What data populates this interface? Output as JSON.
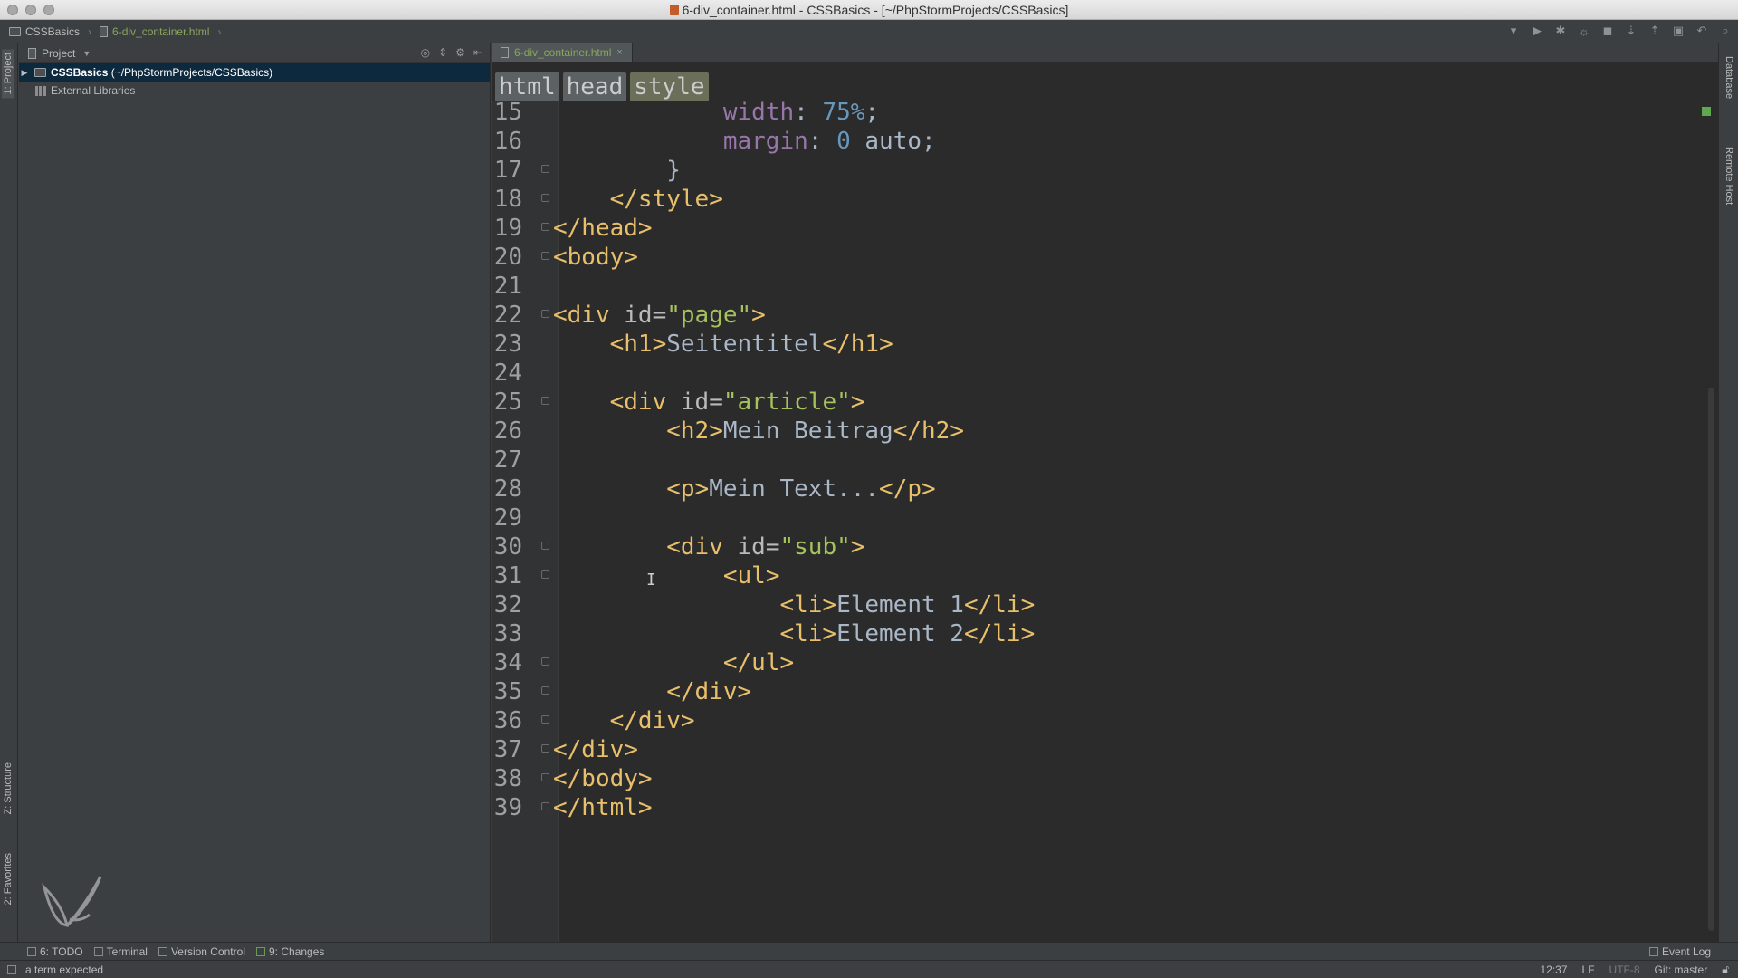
{
  "window": {
    "title": "6-div_container.html - CSSBasics - [~/PhpStormProjects/CSSBasics]"
  },
  "navbar": {
    "project": "CSSBasics",
    "file": "6-div_container.html"
  },
  "left_stripe": {
    "project_tab": "1: Project",
    "structure_tab": "Z: Structure",
    "favorites_tab": "2: Favorites"
  },
  "right_stripe": {
    "database_tab": "Database",
    "remote_host_tab": "Remote Host"
  },
  "project_panel": {
    "header": "Project",
    "tree": [
      {
        "label": "CSSBasics",
        "path": "(~/PhpStormProjects/CSSBasics)",
        "selected": true
      },
      {
        "label": "External Libraries",
        "selected": false
      }
    ]
  },
  "editor": {
    "tab_label": "6-div_container.html",
    "breadcrumbs": [
      "html",
      "head",
      "style"
    ],
    "lines": [
      {
        "num": "15",
        "code": "            width: 75%;"
      },
      {
        "num": "16",
        "code": "            margin: 0 auto;"
      },
      {
        "num": "17",
        "code": "        }"
      },
      {
        "num": "18",
        "code": "    </style>"
      },
      {
        "num": "19",
        "code": "</head>"
      },
      {
        "num": "20",
        "code": "<body>"
      },
      {
        "num": "21",
        "code": ""
      },
      {
        "num": "22",
        "code": "<div id=\"page\">"
      },
      {
        "num": "23",
        "code": "    <h1>Seitentitel</h1>"
      },
      {
        "num": "24",
        "code": ""
      },
      {
        "num": "25",
        "code": "    <div id=\"article\">"
      },
      {
        "num": "26",
        "code": "        <h2>Mein Beitrag</h2>"
      },
      {
        "num": "27",
        "code": ""
      },
      {
        "num": "28",
        "code": "        <p>Mein Text...</p>"
      },
      {
        "num": "29",
        "code": ""
      },
      {
        "num": "30",
        "code": "        <div id=\"sub\">"
      },
      {
        "num": "31",
        "code": "            <ul>"
      },
      {
        "num": "32",
        "code": "                <li>Element 1</li>"
      },
      {
        "num": "33",
        "code": "                <li>Element 2</li>"
      },
      {
        "num": "34",
        "code": "            </ul>"
      },
      {
        "num": "35",
        "code": "        </div>"
      },
      {
        "num": "36",
        "code": "    </div>"
      },
      {
        "num": "37",
        "code": "</div>"
      },
      {
        "num": "38",
        "code": "</body>"
      },
      {
        "num": "39",
        "code": "</html>"
      }
    ]
  },
  "bottom_bar": {
    "todo": "6: TODO",
    "terminal": "Terminal",
    "version_control": "Version Control",
    "changes": "9: Changes",
    "event_log": "Event Log"
  },
  "status_bar": {
    "message": "a term expected",
    "position": "12:37",
    "line_ending": "LF",
    "encoding": "UTF-8",
    "vcs": "Git: master"
  },
  "colors": {
    "tag": "#e8bf6a",
    "string": "#a5c25c",
    "property": "#9876aa",
    "number": "#6897bb",
    "text": "#a9b7c6",
    "selection": "#0d293e"
  }
}
